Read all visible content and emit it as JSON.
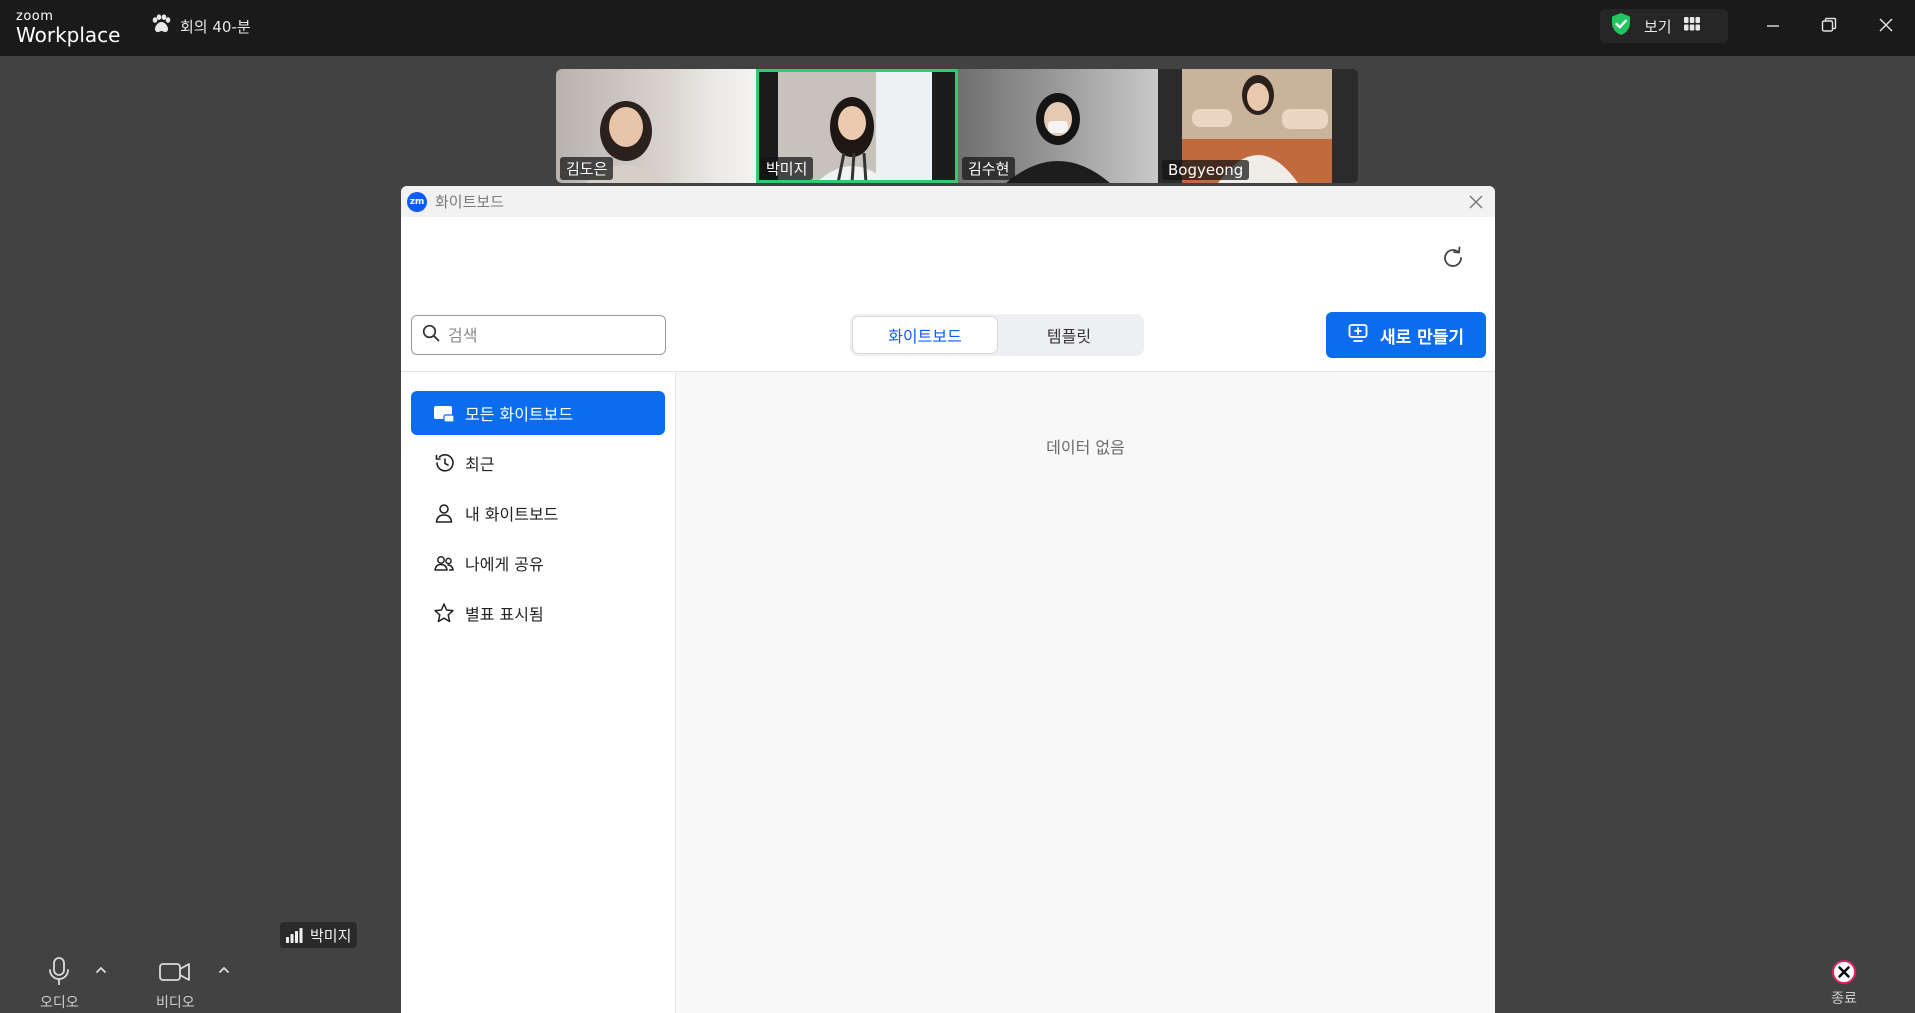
{
  "app": {
    "logo_small": "zoom",
    "logo_big": "Workplace",
    "meeting_title": "회의 40-분",
    "view_label": "보기"
  },
  "participants": [
    {
      "name": "김도은",
      "bg": "#c9c4bf",
      "active": false
    },
    {
      "name": "박미지",
      "bg": "#b5b1aa",
      "active": true
    },
    {
      "name": "김수현",
      "bg": "#5a5a5a",
      "active": false
    },
    {
      "name": "Bogyeong",
      "bg": "#b9a48d",
      "active": false
    }
  ],
  "whiteboard": {
    "window_title": "화이트보드",
    "badge": "zm",
    "search_placeholder": "검색",
    "tabs": [
      {
        "label": "화이트보드",
        "selected": true
      },
      {
        "label": "템플릿",
        "selected": false
      }
    ],
    "new_button": "새로 만들기",
    "nav": [
      {
        "label": "모든 화이트보드",
        "icon": "whiteboard-icon",
        "selected": true
      },
      {
        "label": "최근",
        "icon": "clock-icon",
        "selected": false
      },
      {
        "label": "내 화이트보드",
        "icon": "person-icon",
        "selected": false
      },
      {
        "label": "나에게 공유",
        "icon": "people-icon",
        "selected": false
      },
      {
        "label": "별표 표시됨",
        "icon": "star-icon",
        "selected": false
      }
    ],
    "empty_text": "데이터 없음"
  },
  "toolbar": {
    "audio_label": "오디오",
    "video_label": "비디오",
    "end_label": "종료",
    "speaker_name": "박미지"
  },
  "colors": {
    "accent": "#0b6cf0",
    "active_speaker": "#2ecc71",
    "end": "#e0245e"
  }
}
